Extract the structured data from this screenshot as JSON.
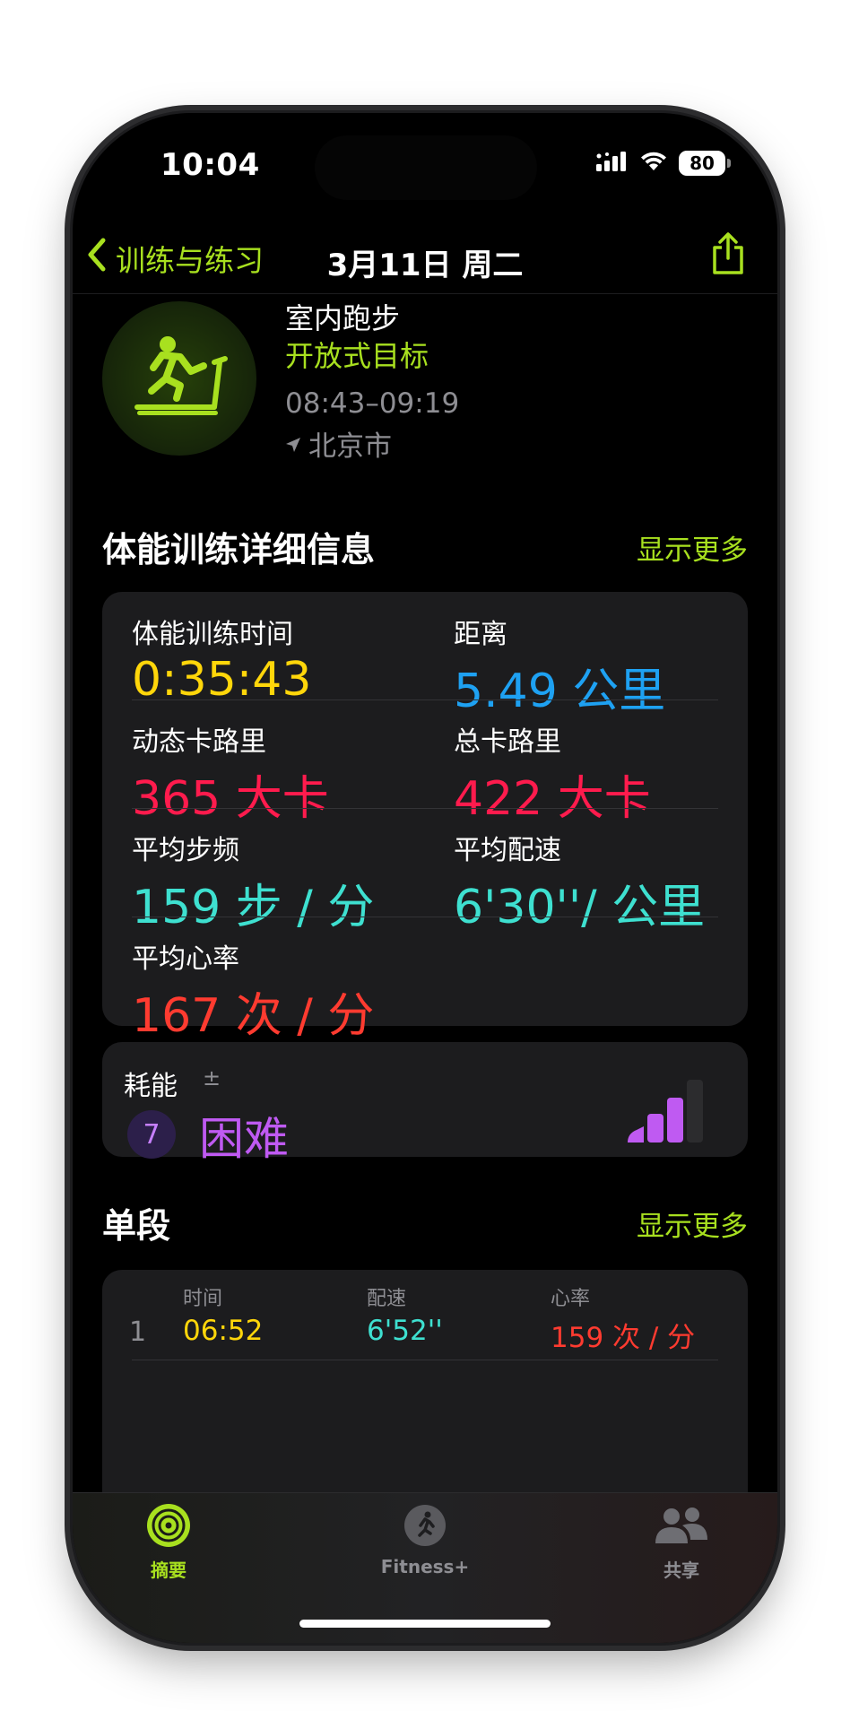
{
  "status_bar": {
    "time": "10:04",
    "battery": "80"
  },
  "nav": {
    "back_label": "训练与练习",
    "title": "3月11日 周二"
  },
  "workout": {
    "type": "室内跑步",
    "goal": "开放式目标",
    "time_range": "08:43–09:19",
    "location": "北京市"
  },
  "details": {
    "title": "体能训练详细信息",
    "more": "显示更多",
    "metrics": [
      {
        "label": "体能训练时间",
        "value": "0:35:43",
        "color": "#ffd60a"
      },
      {
        "label": "距离",
        "value": "5.49 公里",
        "color": "#1ea1f2"
      },
      {
        "label": "动态卡路里",
        "value": "365 大卡",
        "color": "#ff1b4d"
      },
      {
        "label": "总卡路里",
        "value": "422 大卡",
        "color": "#ff1b4d"
      },
      {
        "label": "平均步频",
        "value": "159 步 / 分",
        "color": "#3ee0d0"
      },
      {
        "label": "平均配速",
        "value": "6'30''/ 公里",
        "color": "#3ee0d0"
      },
      {
        "label": "平均心率",
        "value": "167 次 / 分",
        "color": "#ff3b30"
      }
    ]
  },
  "effort": {
    "label": "耗能",
    "pm": "±",
    "level": "7",
    "text": "困难",
    "level_fraction": 0.75
  },
  "laps": {
    "title": "单段",
    "more": "显示更多",
    "headers": [
      "时间",
      "配速",
      "心率"
    ],
    "rows": [
      {
        "num": "1",
        "time": "06:52",
        "pace": "6'52''",
        "hr": "159 次 / 分"
      }
    ]
  },
  "tabbar": {
    "tabs": [
      {
        "label": "摘要",
        "icon": "activity-rings-icon",
        "active": true
      },
      {
        "label": "Fitness+",
        "icon": "fitness-plus-icon",
        "active": false
      },
      {
        "label": "共享",
        "icon": "sharing-people-icon",
        "active": false
      }
    ]
  },
  "colors": {
    "accent": "#a8e01f",
    "effort": "#bf5af2"
  }
}
